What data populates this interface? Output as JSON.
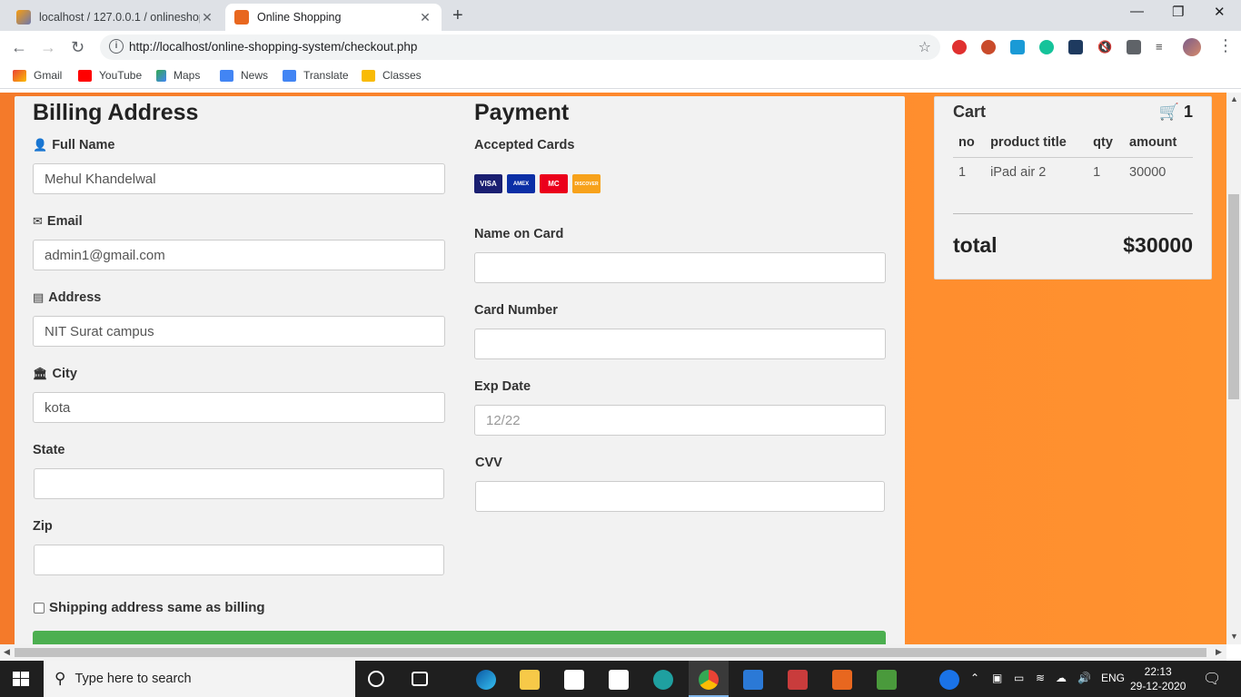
{
  "browser": {
    "tabs": [
      {
        "title": "localhost / 127.0.0.1 / onlineshop",
        "active": false
      },
      {
        "title": "Online Shopping",
        "active": true
      }
    ],
    "url": "http://localhost/online-shopping-system/checkout.php",
    "bookmarks": [
      "Gmail",
      "YouTube",
      "Maps",
      "News",
      "Translate",
      "Classes"
    ]
  },
  "billing": {
    "title": "Billing Address",
    "fullname_label": "Full Name",
    "fullname_value": "Mehul Khandelwal",
    "email_label": "Email",
    "email_value": "admin1@gmail.com",
    "address_label": "Address",
    "address_value": "NIT Surat campus",
    "city_label": "City",
    "city_value": "kota",
    "state_label": "State",
    "zip_label": "Zip",
    "same_shipping_label": "Shipping address same as billing"
  },
  "payment": {
    "title": "Payment",
    "accepted_cards_label": "Accepted Cards",
    "card_brands": [
      "VISA",
      "AMEX",
      "MC",
      "DISCOVER"
    ],
    "name_on_card_label": "Name on Card",
    "card_number_label": "Card Number",
    "exp_date_label": "Exp Date",
    "exp_date_placeholder": "12/22",
    "cvv_label": "CVV"
  },
  "cart": {
    "title": "Cart",
    "item_count": "1",
    "columns": [
      "no",
      "product title",
      "qty",
      "amount"
    ],
    "rows": [
      [
        "1",
        "iPad air 2",
        "1",
        "30000"
      ]
    ],
    "total_label": "total",
    "total_value": "$30000"
  },
  "taskbar": {
    "search_placeholder": "Type here to search",
    "language": "ENG",
    "time": "22:13",
    "date": "29-12-2020"
  },
  "colors": {
    "page_bg": "#ff8a2e",
    "submit_green": "#4caf50"
  }
}
